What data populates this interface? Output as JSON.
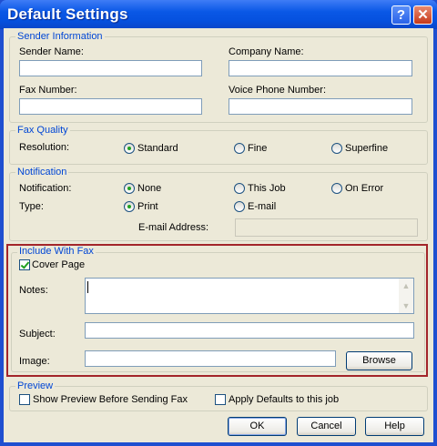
{
  "window": {
    "title": "Default Settings",
    "help_glyph": "?",
    "close_glyph": "✕"
  },
  "sender": {
    "legend": "Sender Information",
    "sender_name_label": "Sender Name:",
    "company_name_label": "Company Name:",
    "fax_number_label": "Fax Number:",
    "voice_phone_label": "Voice Phone Number:"
  },
  "quality": {
    "legend": "Fax Quality",
    "resolution_label": "Resolution:",
    "options": [
      "Standard",
      "Fine",
      "Superfine"
    ],
    "selected": "Standard"
  },
  "notification": {
    "legend": "Notification",
    "notification_label": "Notification:",
    "notification_options": [
      "None",
      "This Job",
      "On Error"
    ],
    "notification_selected": "None",
    "type_label": "Type:",
    "type_options": [
      "Print",
      "E-mail"
    ],
    "type_selected": "Print",
    "email_label": "E-mail Address:"
  },
  "include": {
    "legend": "Include With Fax",
    "cover_page_label": "Cover Page",
    "cover_page_checked": true,
    "notes_label": "Notes:",
    "subject_label": "Subject:",
    "image_label": "Image:",
    "browse_label": "Browse"
  },
  "preview": {
    "legend": "Preview",
    "show_preview_label": "Show Preview Before Sending Fax",
    "apply_defaults_label": "Apply Defaults to this job"
  },
  "footer": {
    "ok_label": "OK",
    "cancel_label": "Cancel",
    "help_label": "Help"
  },
  "colors": {
    "titlebar": "#0a58e6",
    "legend_text": "#0046d5",
    "highlight_border": "#a3252a"
  }
}
